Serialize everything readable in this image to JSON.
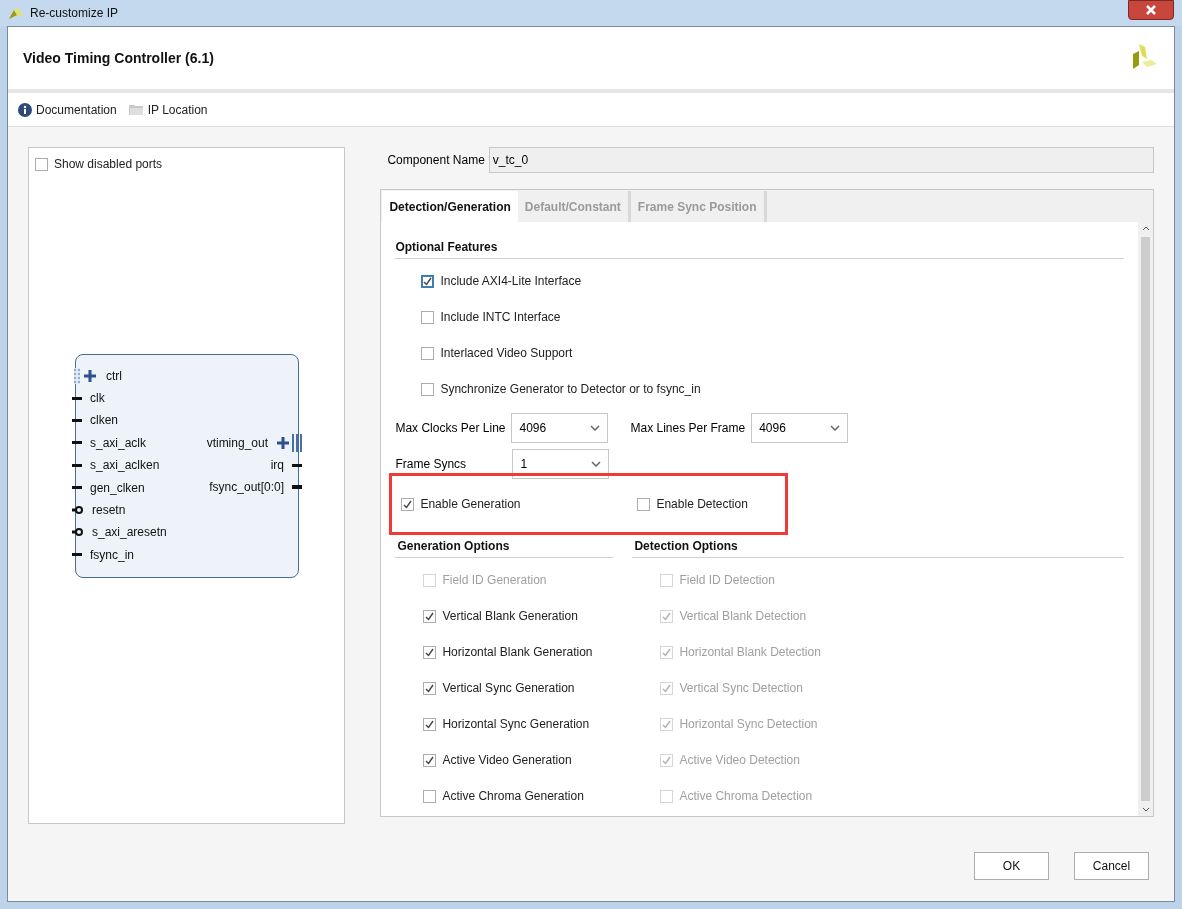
{
  "window": {
    "title": "Re-customize IP"
  },
  "header": {
    "title": "Video Timing Controller (6.1)"
  },
  "toolbar": [
    {
      "label": "Documentation",
      "kind": "info"
    },
    {
      "label": "IP Location",
      "kind": "folder"
    }
  ],
  "symbol_panel": {
    "show_disabled_ports": {
      "label": "Show disabled ports",
      "checked": false
    },
    "left_ports": [
      {
        "name": "ctrl",
        "kind": "bus"
      },
      {
        "name": "clk",
        "kind": "wire"
      },
      {
        "name": "clken",
        "kind": "wire"
      },
      {
        "name": "s_axi_aclk",
        "kind": "wire"
      },
      {
        "name": "s_axi_aclken",
        "kind": "wire"
      },
      {
        "name": "gen_clken",
        "kind": "wire"
      },
      {
        "name": "resetn",
        "kind": "reset"
      },
      {
        "name": "s_axi_aresetn",
        "kind": "reset"
      },
      {
        "name": "fsync_in",
        "kind": "wire"
      }
    ],
    "right_ports": [
      {
        "name": "vtiming_out",
        "kind": "bus"
      },
      {
        "name": "irq",
        "kind": "wire"
      },
      {
        "name": "fsync_out[0:0]",
        "kind": "vector"
      }
    ]
  },
  "component_name": {
    "label": "Component Name",
    "value": "v_tc_0"
  },
  "tabs": [
    {
      "label": "Detection/Generation",
      "selected": true
    },
    {
      "label": "Default/Constant",
      "selected": false
    },
    {
      "label": "Frame Sync Position",
      "selected": false
    }
  ],
  "optional_features": {
    "title": "Optional Features",
    "options": [
      {
        "label": "Include AXI4-Lite Interface",
        "checked": true,
        "focused": true
      },
      {
        "label": "Include INTC Interface",
        "checked": false,
        "focused": false
      },
      {
        "label": "Interlaced Video Support",
        "checked": false,
        "focused": false
      },
      {
        "label": "Synchronize Generator to Detector or to fsync_in",
        "checked": false,
        "focused": false
      }
    ]
  },
  "selects": [
    {
      "label": "Max Clocks Per Line",
      "value": "4096"
    },
    {
      "label": "Max Lines Per Frame",
      "value": "4096"
    },
    {
      "label": "Frame Syncs",
      "value": "1"
    }
  ],
  "enable": {
    "highlighted": true,
    "options": [
      {
        "label": "Enable Generation",
        "checked": true
      },
      {
        "label": "Enable Detection",
        "checked": false
      }
    ]
  },
  "columns": [
    {
      "title": "Generation Options",
      "options": [
        {
          "label": "Field ID Generation",
          "checked": false,
          "disabled": true
        },
        {
          "label": "Vertical Blank Generation",
          "checked": true,
          "disabled": false
        },
        {
          "label": "Horizontal Blank Generation",
          "checked": true,
          "disabled": false
        },
        {
          "label": "Vertical Sync Generation",
          "checked": true,
          "disabled": false
        },
        {
          "label": "Horizontal Sync Generation",
          "checked": true,
          "disabled": false
        },
        {
          "label": "Active Video Generation",
          "checked": true,
          "disabled": false
        },
        {
          "label": "Active Chroma Generation",
          "checked": false,
          "disabled": false
        }
      ]
    },
    {
      "title": "Detection Options",
      "options": [
        {
          "label": "Field ID Detection",
          "checked": false,
          "disabled": true
        },
        {
          "label": "Vertical Blank Detection",
          "checked": true,
          "disabled": true
        },
        {
          "label": "Horizontal Blank Detection",
          "checked": true,
          "disabled": true
        },
        {
          "label": "Vertical Sync Detection",
          "checked": true,
          "disabled": true
        },
        {
          "label": "Horizontal Sync Detection",
          "checked": true,
          "disabled": true
        },
        {
          "label": "Active Video Detection",
          "checked": true,
          "disabled": true
        },
        {
          "label": "Active Chroma Detection",
          "checked": false,
          "disabled": true
        }
      ]
    }
  ],
  "buttons": [
    "OK",
    "Cancel"
  ]
}
